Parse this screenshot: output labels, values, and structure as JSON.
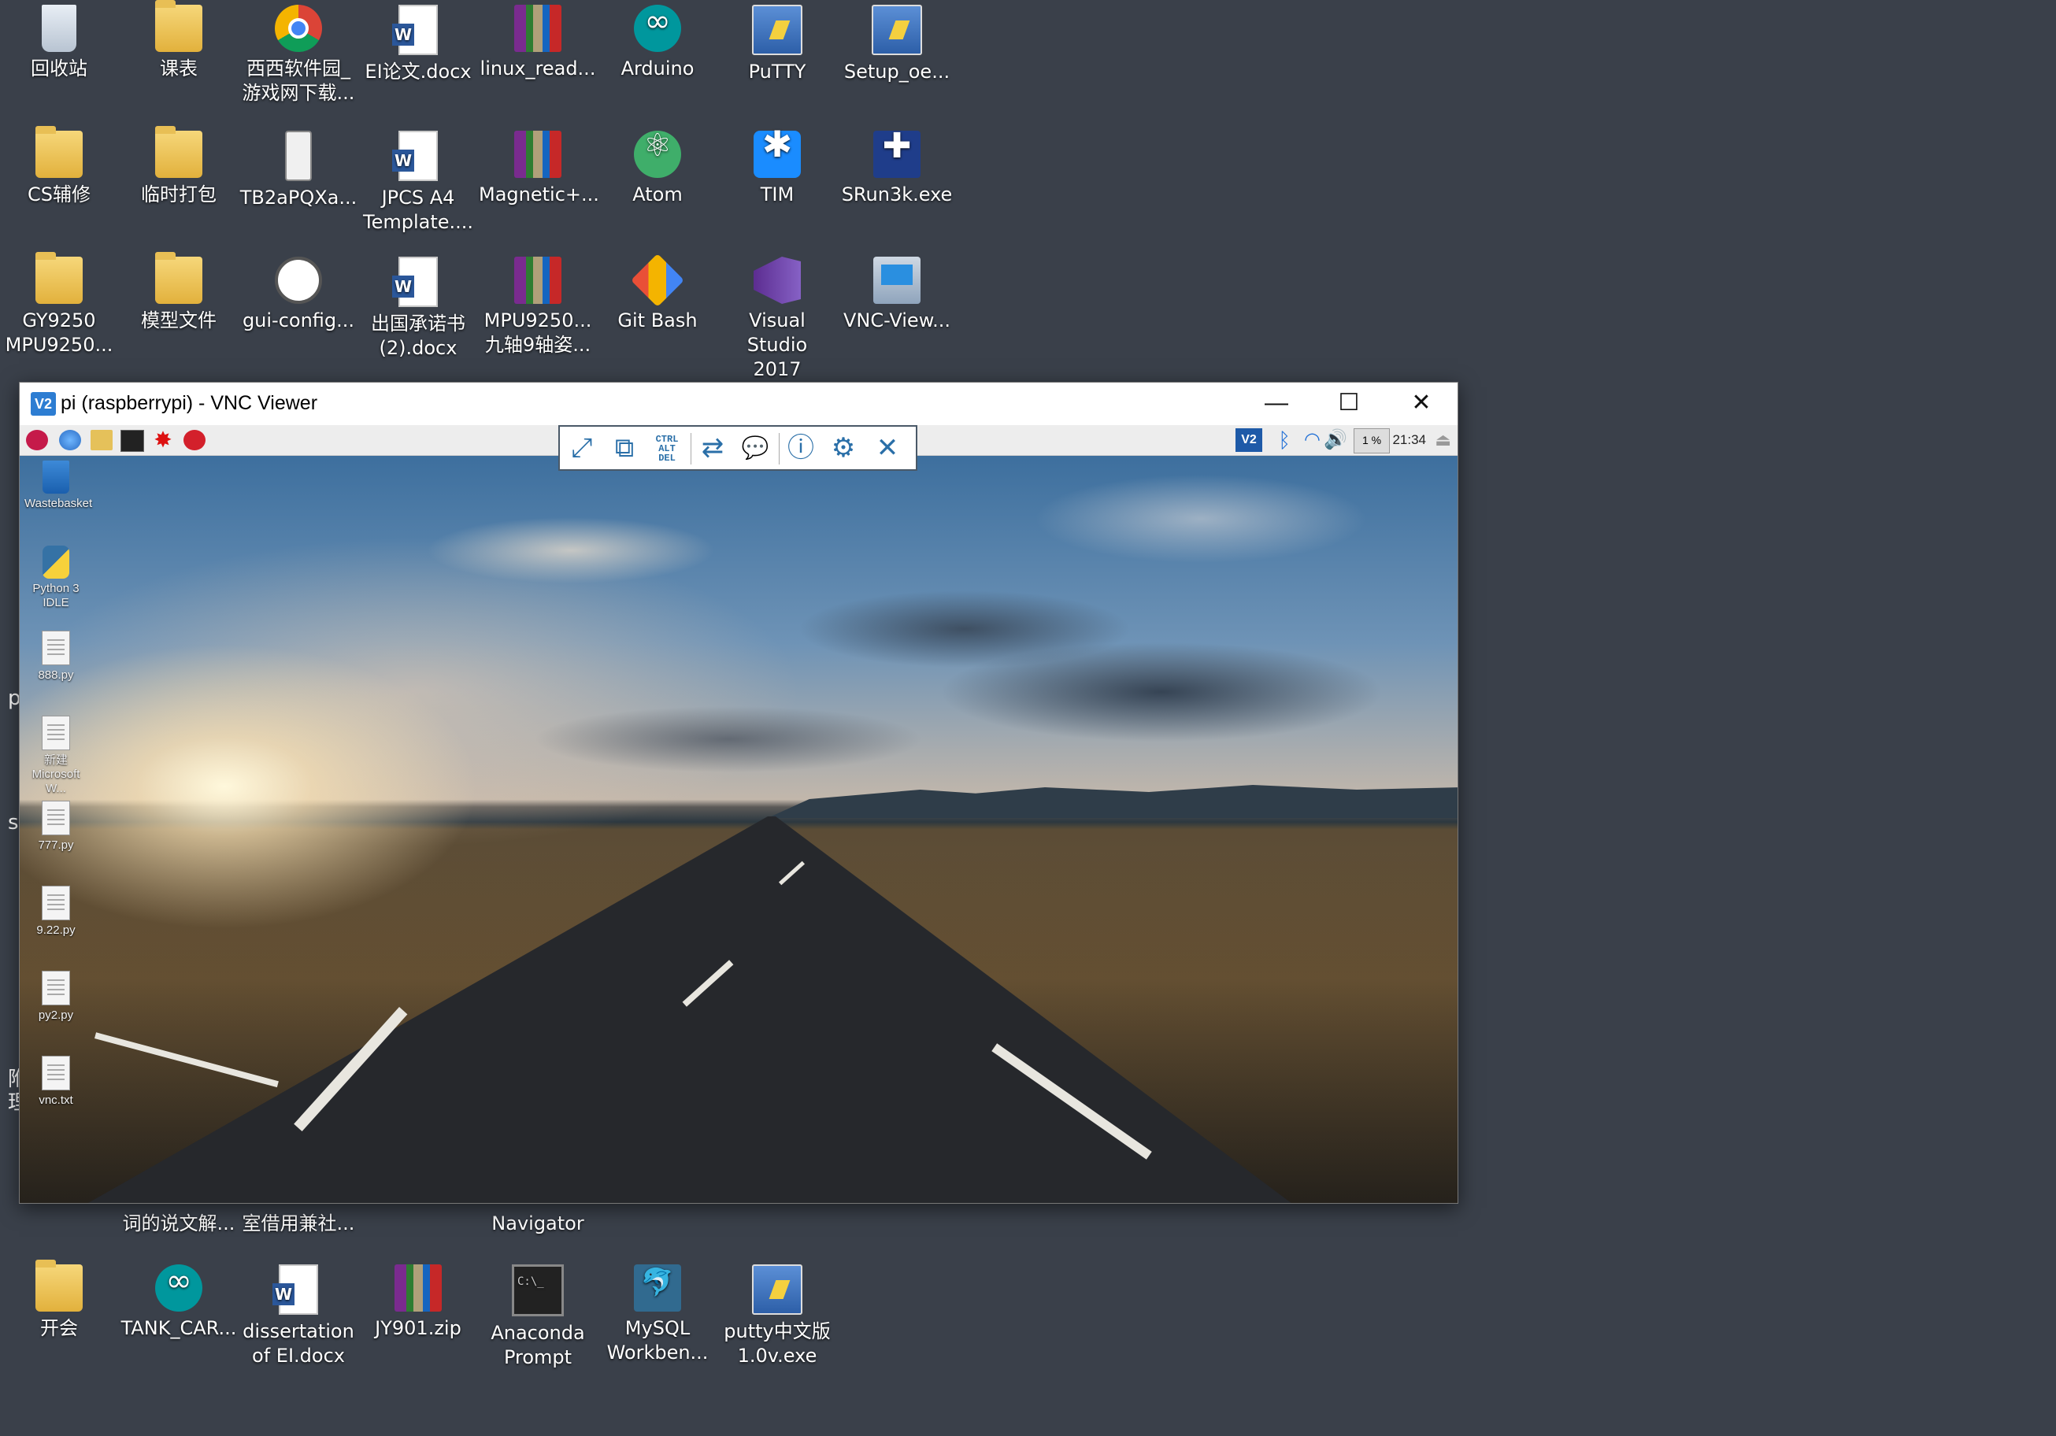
{
  "desktop": {
    "icons_top": [
      {
        "label": "回收站",
        "icon": "recycle-bin-icon",
        "style": "ic-bin",
        "col": 0,
        "row": 0
      },
      {
        "label": "课表",
        "icon": "folder-icon",
        "style": "ic-folder",
        "col": 1,
        "row": 0
      },
      {
        "label": "西西软件园_\n游戏网下载...",
        "icon": "chrome-icon",
        "style": "ic-chrome",
        "col": 2,
        "row": 0
      },
      {
        "label": "EI论文.docx",
        "icon": "word-document-icon",
        "style": "ic-doc",
        "col": 3,
        "row": 0
      },
      {
        "label": "linux_read...",
        "icon": "winrar-archive-icon",
        "style": "ic-rar",
        "col": 4,
        "row": 0
      },
      {
        "label": "Arduino",
        "icon": "arduino-icon",
        "style": "ic-arduino",
        "col": 5,
        "row": 0
      },
      {
        "label": "PuTTY",
        "icon": "putty-icon",
        "style": "ic-pc",
        "col": 6,
        "row": 0
      },
      {
        "label": "Setup_oe...",
        "icon": "setup-installer-icon",
        "style": "ic-pc",
        "col": 7,
        "row": 0
      },
      {
        "label": "CS辅修",
        "icon": "folder-icon",
        "style": "ic-folder",
        "col": 0,
        "row": 1
      },
      {
        "label": "临时打包",
        "icon": "folder-icon",
        "style": "ic-folder",
        "col": 1,
        "row": 1
      },
      {
        "label": "TB2aPQXa...",
        "icon": "phone-image-icon",
        "style": "ic-phone",
        "col": 2,
        "row": 1
      },
      {
        "label": "JPCS A4\nTemplate....",
        "icon": "word-document-icon",
        "style": "ic-doc",
        "col": 3,
        "row": 1
      },
      {
        "label": "Magnetic+...",
        "icon": "winrar-archive-icon",
        "style": "ic-rar",
        "col": 4,
        "row": 1
      },
      {
        "label": "Atom",
        "icon": "atom-icon",
        "style": "ic-atom",
        "col": 5,
        "row": 1
      },
      {
        "label": "TIM",
        "icon": "tim-icon",
        "style": "ic-tim",
        "col": 6,
        "row": 1
      },
      {
        "label": "SRun3k.exe",
        "icon": "srun-icon",
        "style": "ic-srun",
        "col": 7,
        "row": 1
      },
      {
        "label": "GY9250\nMPU9250...",
        "icon": "folder-icon",
        "style": "ic-folder",
        "col": 0,
        "row": 2
      },
      {
        "label": "模型文件",
        "icon": "folder-icon",
        "style": "ic-folder",
        "col": 1,
        "row": 2
      },
      {
        "label": "gui-config...",
        "icon": "gui-config-icon",
        "style": "ic-gui",
        "col": 2,
        "row": 2
      },
      {
        "label": "出国承诺书\n(2).docx",
        "icon": "word-document-icon",
        "style": "ic-doc",
        "col": 3,
        "row": 2
      },
      {
        "label": "MPU9250...\n九轴9轴姿...",
        "icon": "winrar-archive-icon",
        "style": "ic-rar",
        "col": 4,
        "row": 2
      },
      {
        "label": "Git Bash",
        "icon": "git-bash-icon",
        "style": "ic-git",
        "col": 5,
        "row": 2
      },
      {
        "label": "Visual Studio\n2017",
        "icon": "visual-studio-icon",
        "style": "ic-vs",
        "col": 6,
        "row": 2
      },
      {
        "label": "VNC-View...",
        "icon": "vnc-viewer-installer-icon",
        "style": "ic-vnc",
        "col": 7,
        "row": 2
      }
    ],
    "partial_labels": [
      {
        "text": "词的说文解...",
        "col": 1
      },
      {
        "text": "室借用兼社...",
        "col": 2
      },
      {
        "text": "Navigator",
        "col": 4
      }
    ],
    "icons_bottom": [
      {
        "label": "开会",
        "icon": "folder-icon",
        "style": "ic-folder",
        "col": 0
      },
      {
        "label": "TANK_CAR...",
        "icon": "arduino-icon",
        "style": "ic-arduino",
        "col": 1
      },
      {
        "label": "dissertation\nof EI.docx",
        "icon": "word-document-icon",
        "style": "ic-doc",
        "col": 2
      },
      {
        "label": "JY901.zip",
        "icon": "winrar-archive-icon",
        "style": "ic-rar",
        "col": 3
      },
      {
        "label": "Anaconda\nPrompt",
        "icon": "terminal-icon",
        "style": "ic-term",
        "col": 4
      },
      {
        "label": "MySQL\nWorkben...",
        "icon": "mysql-workbench-icon",
        "style": "ic-mysql",
        "col": 5
      },
      {
        "label": "putty中文版\n1.0v.exe",
        "icon": "putty-icon",
        "style": "ic-pc",
        "col": 6
      }
    ],
    "edge_fragments": [
      "p",
      "sl",
      "附",
      "理"
    ]
  },
  "vnc_window": {
    "title": "pi (raspberrypi) - VNC Viewer",
    "app_badge": "V2",
    "controls": {
      "minimize": "—",
      "maximize": "☐",
      "close": "✕"
    },
    "toolbar": {
      "fullscreen": "⤢",
      "scale": "⧉",
      "ctrl_alt_del": "CTRL\nALT\nDEL",
      "transfer": "⇄",
      "chat": "💬",
      "info": "ⓘ",
      "settings": "⚙",
      "close": "✕"
    },
    "pi_panel": {
      "vnc_badge": "V2",
      "bluetooth": "ᛒ",
      "wifi": "◠",
      "volume": "🔊",
      "cpu": "1 %",
      "clock": "21:34",
      "eject": "⏏"
    },
    "pi_desktop_icons": [
      {
        "label": "Wastebasket",
        "type": "pico-bin"
      },
      {
        "label": "Python 3\nIDLE",
        "type": "pico-py"
      },
      {
        "label": "888.py",
        "type": "pico-file"
      },
      {
        "label": "新建\nMicrosoft W...",
        "type": "pico-file"
      },
      {
        "label": "777.py",
        "type": "pico-file"
      },
      {
        "label": "9.22.py",
        "type": "pico-file"
      },
      {
        "label": "py2.py",
        "type": "pico-file"
      },
      {
        "label": "vnc.txt",
        "type": "pico-file"
      }
    ]
  },
  "colors": {
    "desktop_bg": "#3a404a",
    "accent": "#2a6fa8"
  }
}
